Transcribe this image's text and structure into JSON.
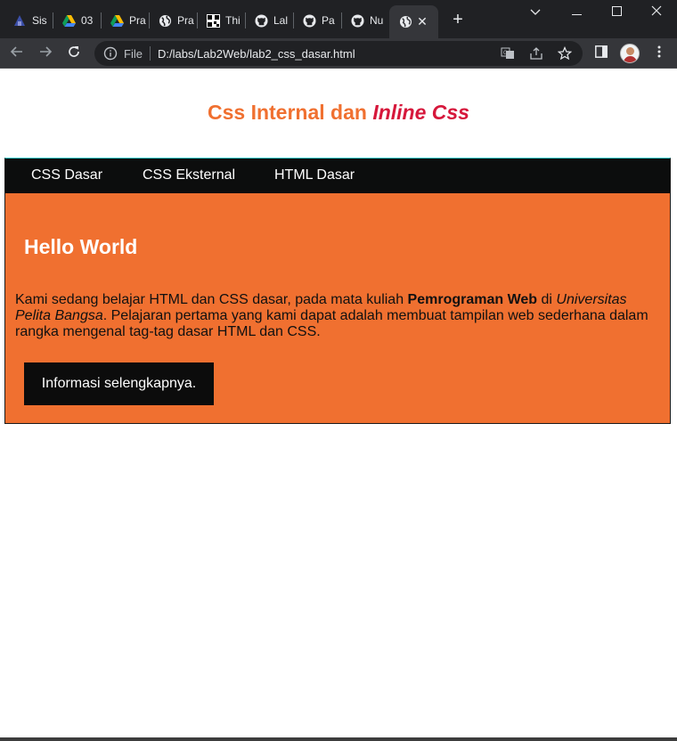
{
  "browser": {
    "tabs": [
      {
        "label": "Sis",
        "icon": "university-logo-icon"
      },
      {
        "label": "03",
        "icon": "google-drive-icon"
      },
      {
        "label": "Pra",
        "icon": "google-drive-icon"
      },
      {
        "label": "Pra",
        "icon": "globe-icon"
      },
      {
        "label": "Thi",
        "icon": "qr-code-icon"
      },
      {
        "label": "Lal",
        "icon": "github-icon"
      },
      {
        "label": "Pa",
        "icon": "github-icon"
      },
      {
        "label": "Nu",
        "icon": "github-icon"
      }
    ],
    "active_tab": {
      "icon": "globe-icon",
      "close": "✕"
    },
    "new_tab": "+",
    "window_controls": {
      "dropdown": "chevron-down-icon",
      "minimize": "minimize-icon",
      "maximize": "maximize-icon",
      "close": "close-icon"
    },
    "address": {
      "scheme": "File",
      "url": "D:/labs/Lab2Web/lab2_css_dasar.html"
    },
    "colors": {
      "tabbar": "#202124",
      "toolbar": "#35363a",
      "omnibox": "#202124"
    }
  },
  "page": {
    "title_normal": "Css Internal dan ",
    "title_inline": "Inline Css",
    "nav": [
      "CSS Dasar",
      "CSS Eksternal",
      "HTML Dasar"
    ],
    "hero": {
      "heading": "Hello World",
      "text_1": "Kami sedang belajar HTML dan CSS dasar, pada mata kuliah ",
      "text_bold": "Pemrograman Web",
      "text_2": " di ",
      "text_italic": "Universitas Pelita Bangsa",
      "text_3": ". Pelajaran pertama yang kami dapat adalah membuat tampilan web sederhana dalam rangka mengenal tag-tag dasar HTML dan CSS.",
      "button": "Informasi selengkapnya."
    },
    "colors": {
      "accent": "#f07030",
      "inline_title": "#d6173b",
      "nav_bg": "#0c0d0d",
      "button_bg": "#0c0c0c"
    }
  }
}
